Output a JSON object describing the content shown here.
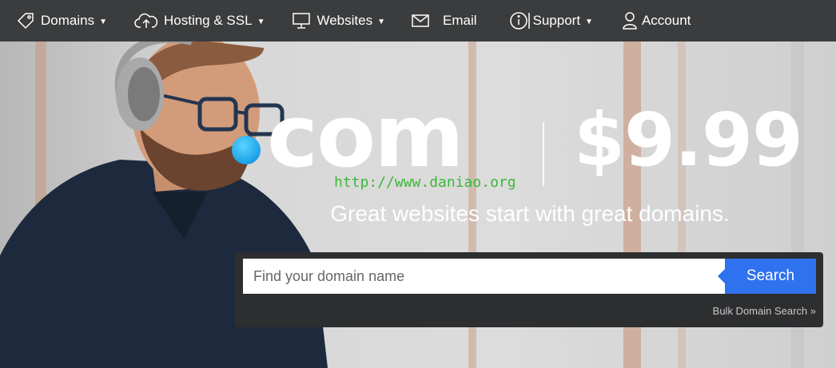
{
  "nav": {
    "items": [
      {
        "label": "Domains",
        "icon": "tag-icon",
        "has_caret": true
      },
      {
        "label": "Hosting & SSL",
        "icon": "cloud-upload-icon",
        "has_caret": true
      },
      {
        "label": "Websites",
        "icon": "monitor-icon",
        "has_caret": true
      },
      {
        "label": "Email",
        "icon": "envelope-icon",
        "has_caret": false
      },
      {
        "label": "Support",
        "icon": "info-icon",
        "has_caret": true
      },
      {
        "label": "Account",
        "icon": "user-icon",
        "has_caret": false
      }
    ]
  },
  "hero": {
    "com_text": "com",
    "price": "$9.99",
    "watermark": "http://www.daniao.org",
    "tagline": "Great websites start with great domains."
  },
  "search": {
    "placeholder": "Find your domain name",
    "button_label": "Search",
    "bulk_link": "Bulk Domain Search »"
  },
  "colors": {
    "nav_bg": "#3b3c3d",
    "search_button": "#2f72f0",
    "search_box_bg": "#2d2e30",
    "dot_accent": "#1aa0e8",
    "watermark": "#3ab83a"
  }
}
